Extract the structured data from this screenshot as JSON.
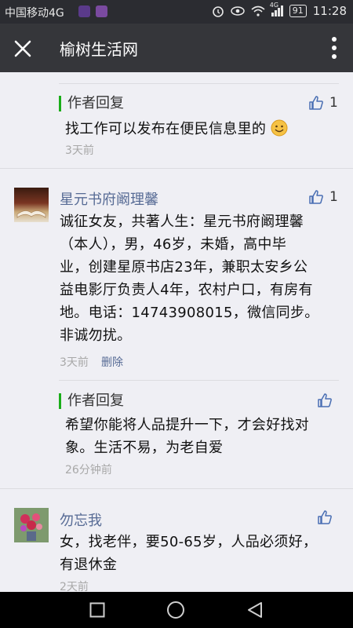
{
  "status_bar": {
    "carrier": "中国移动4G",
    "network": "4G",
    "battery": "91",
    "time": "11:28"
  },
  "header": {
    "title": "榆树生活网"
  },
  "comments": [
    {
      "reply_label": "作者回复",
      "likes": "1",
      "text": "找工作可以发布在便民信息里的",
      "emoji": "smile-emoji",
      "time": "3天前"
    },
    {
      "author": "星元书府阚理馨",
      "likes": "1",
      "lines": [
        "诚征女友，共著人生：星元书府阚理馨",
        "（本人），男，46岁，未婚，高中毕",
        "业，创建星原书店23年，兼职太安乡公",
        "益电影厅负责人4年，农村户口，有房有",
        "地。电话：14743908015，微信同步。",
        "非诚勿扰。"
      ],
      "time": "3天前",
      "delete_label": "删除",
      "reply": {
        "reply_label": "作者回复",
        "lines": [
          "希望你能将人品提升一下，才会好找对",
          "象。生活不易，为老自爱"
        ],
        "time": "26分钟前"
      }
    },
    {
      "author": "勿忘我",
      "lines": [
        "女，找老伴，要50-65岁，人品必须好，",
        "有退休金"
      ],
      "time": "2天前"
    }
  ],
  "colors": {
    "accent_green": "#1aad19",
    "name_blue": "#576b95",
    "like_blue": "#4a6fb3"
  }
}
